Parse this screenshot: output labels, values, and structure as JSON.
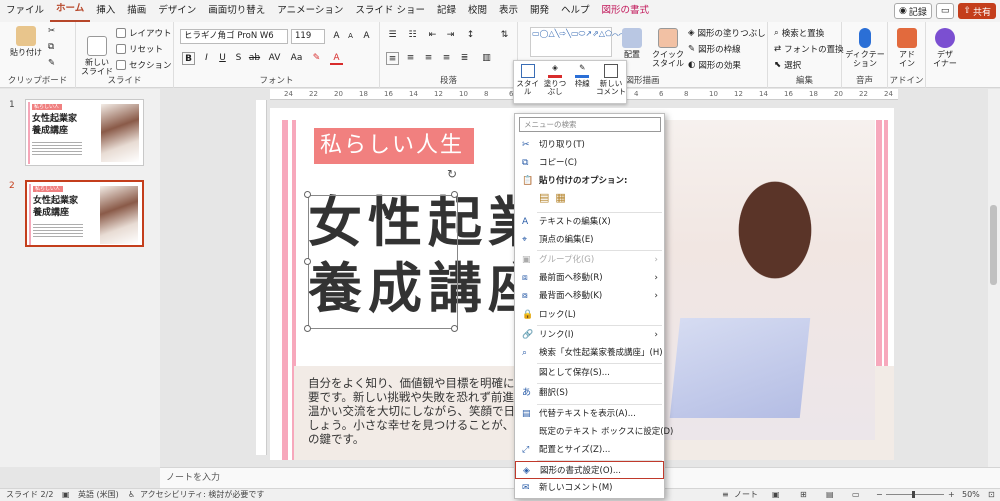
{
  "menu": {
    "tabs": [
      "ファイル",
      "ホーム",
      "挿入",
      "描画",
      "デザイン",
      "画面切り替え",
      "アニメーション",
      "スライド ショー",
      "記録",
      "校閲",
      "表示",
      "開発",
      "ヘルプ",
      "図形の書式"
    ],
    "record": "記録",
    "share": "共有"
  },
  "ribbon": {
    "clipboard": {
      "paste": "貼り付け",
      "label": "クリップボード"
    },
    "slides": {
      "new_slide": "新しい\nスライド",
      "layout": "レイアウト",
      "reset": "リセット",
      "section": "セクション",
      "label": "スライド"
    },
    "font": {
      "name": "ヒラギノ角ゴ ProN W6",
      "size": "119",
      "label": "フォント"
    },
    "paragraph": {
      "label": "段落"
    },
    "drawing": {
      "arrange": "配置",
      "quick_style": "クイック\nスタイル",
      "fill": "図形の塗りつぶし",
      "outline": "図形の枠線",
      "effects": "図形の効果",
      "label": "図形描画"
    },
    "editing": {
      "find_replace": "検索と置換",
      "replace_font": "フォントの置換",
      "select": "選択",
      "label": "編集"
    },
    "voice": {
      "dictate": "ディクテー\nション",
      "label": "音声"
    },
    "addins": {
      "addin": "アド\nイン",
      "label": "アドイン"
    },
    "designer": {
      "label": "デザ\nイナー"
    }
  },
  "mini_toolbar": {
    "style": "スタイ\nル",
    "fill": "塗りつ\nぶし",
    "outline": "枠線",
    "new_comment": "新しい\nコメント"
  },
  "thumbnails": [
    {
      "number": "1",
      "tag": "私らしい人生",
      "title": "女性起業家\n養成講座"
    },
    {
      "number": "2",
      "tag": "私らしい人生",
      "title": "女性起業家\n養成講座"
    }
  ],
  "ruler": {
    "ticks": [
      "24",
      "22",
      "20",
      "18",
      "16",
      "14",
      "12",
      "10",
      "8",
      "6",
      "4",
      "2",
      "0",
      "2",
      "4",
      "6",
      "8",
      "10",
      "12",
      "14",
      "16",
      "18",
      "20",
      "22",
      "24"
    ]
  },
  "slide": {
    "tag": "私らしい人生",
    "title_line1": "女性起業",
    "title_line2": "養成講座",
    "paragraph": "自分をよく知り、価値観や目標を明確に\n要です。新しい挑戦や失敗を恐れず前進\n温かい交流を大切にしながら、笑顔で日\nしょう。小さな幸せを見つけることが、\nの鍵です。"
  },
  "context_menu": {
    "search_placeholder": "メニューの検索",
    "items": [
      {
        "label": "切り取り(T)",
        "icon": "scissors-icon",
        "enabled": true
      },
      {
        "label": "コピー(C)",
        "icon": "copy-icon",
        "enabled": true
      },
      {
        "label": "貼り付けのオプション:",
        "icon": "clipboard-icon",
        "enabled": true,
        "bold": true
      },
      {
        "label": "テキストの編集(X)",
        "icon": "edit-text-icon",
        "enabled": true
      },
      {
        "label": "頂点の編集(E)",
        "icon": "edit-points-icon",
        "enabled": true
      },
      {
        "label": "グループ化(G)",
        "icon": "group-icon",
        "enabled": false,
        "submenu": true
      },
      {
        "label": "最前面へ移動(R)",
        "icon": "bring-front-icon",
        "enabled": true,
        "submenu": true
      },
      {
        "label": "最背面へ移動(K)",
        "icon": "send-back-icon",
        "enabled": true,
        "submenu": true
      },
      {
        "label": "ロック(L)",
        "icon": "lock-icon",
        "enabled": true
      },
      {
        "label": "リンク(I)",
        "icon": "link-icon",
        "enabled": true,
        "submenu": true
      },
      {
        "label": "検索「女性起業家養成講座」(H)",
        "icon": "search-icon",
        "enabled": true
      },
      {
        "label": "図として保存(S)...",
        "icon": "",
        "enabled": true
      },
      {
        "label": "翻訳(S)",
        "icon": "translate-icon",
        "enabled": true
      },
      {
        "label": "代替テキストを表示(A)...",
        "icon": "alt-text-icon",
        "enabled": true
      },
      {
        "label": "既定のテキスト ボックスに設定(D)",
        "icon": "",
        "enabled": true
      },
      {
        "label": "配置とサイズ(Z)...",
        "icon": "size-icon",
        "enabled": true
      },
      {
        "label": "図形の書式設定(O)...",
        "icon": "format-shape-icon",
        "enabled": true,
        "highlighted": true
      },
      {
        "label": "新しいコメント(M)",
        "icon": "comment-icon",
        "enabled": true
      }
    ]
  },
  "notes": {
    "placeholder": "ノートを入力"
  },
  "status": {
    "slide": "スライド 2/2",
    "language": "英語 (米国)",
    "accessibility": "アクセシビリティ: 検討が必要です",
    "notes": "ノート",
    "zoom": "50%"
  }
}
